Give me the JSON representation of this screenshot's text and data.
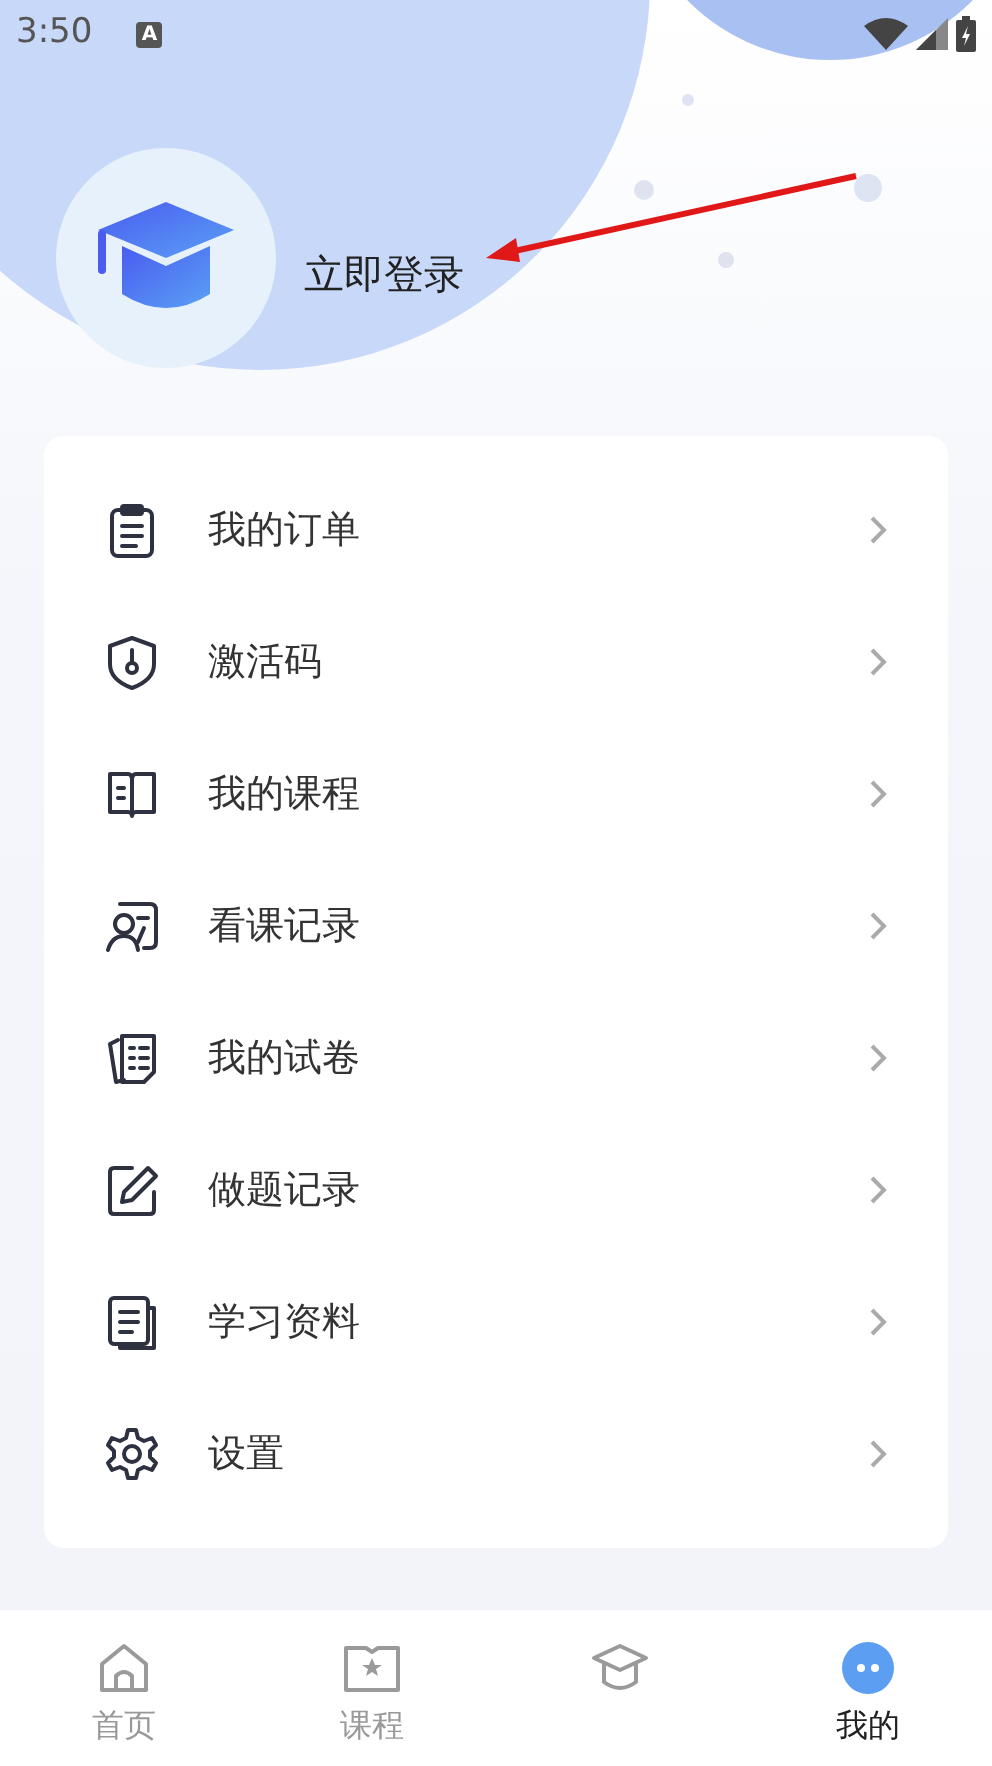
{
  "status_bar": {
    "time": "3:50",
    "notification": "A"
  },
  "profile": {
    "login_label": "立即登录"
  },
  "menu": [
    {
      "label": "我的订单"
    },
    {
      "label": "激活码"
    },
    {
      "label": "我的课程"
    },
    {
      "label": "看课记录"
    },
    {
      "label": "我的试卷"
    },
    {
      "label": "做题记录"
    },
    {
      "label": "学习资料"
    },
    {
      "label": "设置"
    }
  ],
  "tab_bar": [
    {
      "label": "首页",
      "selected": false
    },
    {
      "label": "课程",
      "selected": false
    },
    {
      "selected": false
    },
    {
      "label": "我的",
      "selected": true
    }
  ]
}
